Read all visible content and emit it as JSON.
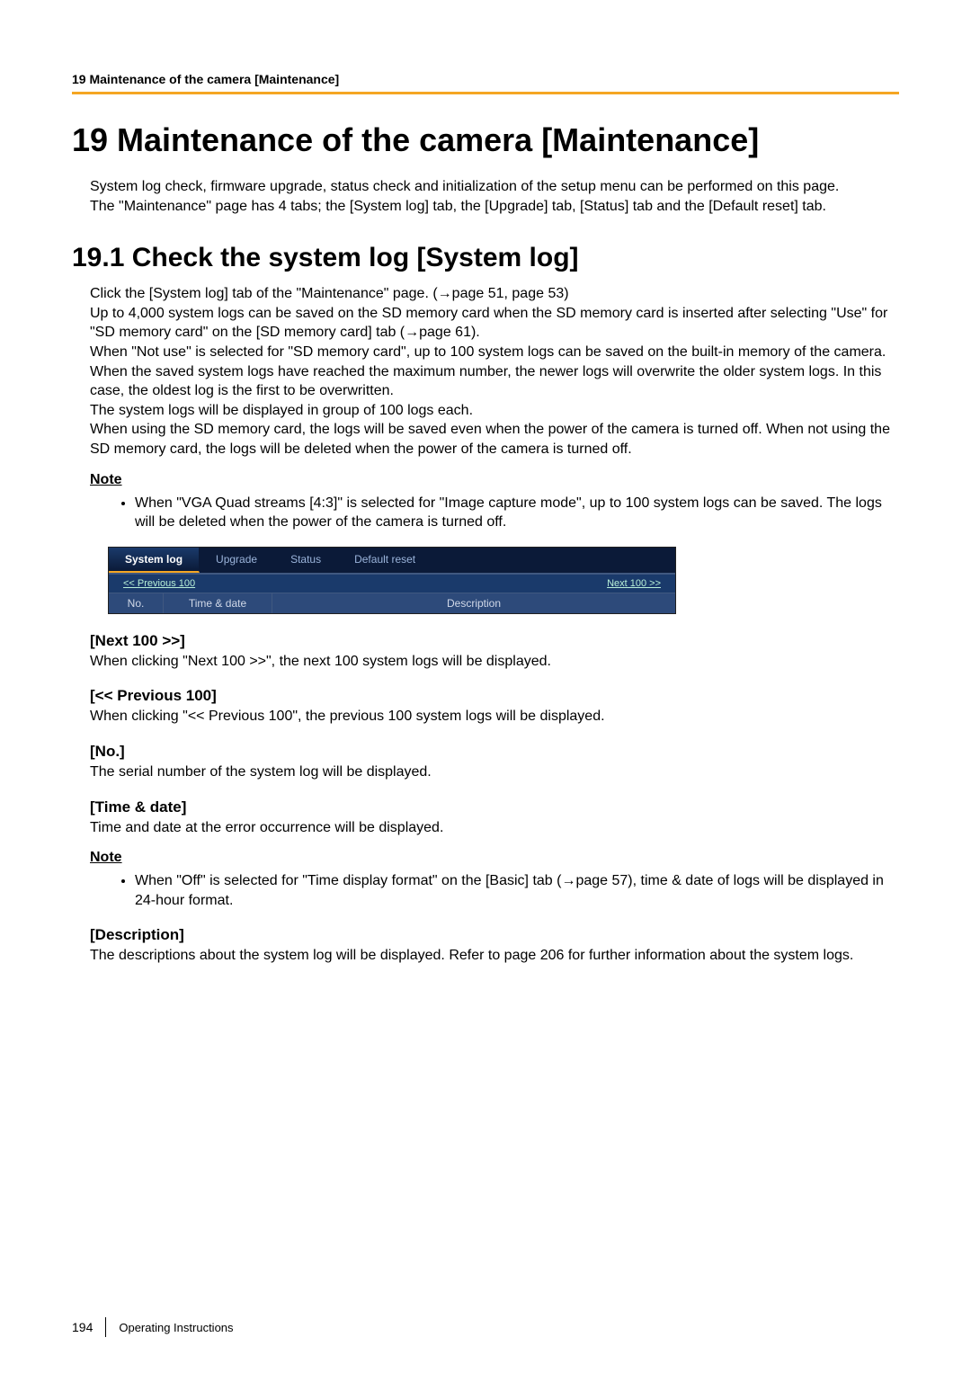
{
  "running_header": "19 Maintenance of the camera [Maintenance]",
  "chapter_title": "19   Maintenance of the camera [Maintenance]",
  "intro_p1": "System log check, firmware upgrade, status check and initialization of the setup menu can be performed on this page.",
  "intro_p2": "The \"Maintenance\" page has 4 tabs; the [System log] tab, the [Upgrade] tab, [Status] tab and the [Default reset] tab.",
  "section_title": "19.1  Check the system log [System log]",
  "body_lines": {
    "l1": "Click the [System log] tab of the \"Maintenance\" page. (→page 51, page 53)",
    "l2": "Up to 4,000 system logs can be saved on the SD memory card when the SD memory card is inserted after selecting \"Use\" for \"SD memory card\" on the [SD memory card] tab (→page 61).",
    "l3": "When \"Not use\" is selected for \"SD memory card\", up to 100 system logs can be saved on the built-in memory of the camera.",
    "l4": "When the saved system logs have reached the maximum number, the newer logs will overwrite the older system logs. In this case, the oldest log is the first to be overwritten.",
    "l5": "The system logs will be displayed in group of 100 logs each.",
    "l6": "When using the SD memory card, the logs will be saved even when the power of the camera is turned off. When not using the SD memory card, the logs will be deleted when the power of the camera is turned off."
  },
  "note1_heading": "Note",
  "note1_item": "When \"VGA Quad streams [4:3]\" is selected for \"Image capture mode\", up to 100 system logs can be saved. The logs will be deleted when the power of the camera is turned off.",
  "ui": {
    "tabs": {
      "system_log": "System log",
      "upgrade": "Upgrade",
      "status": "Status",
      "default_reset": "Default reset"
    },
    "prev_link": "<< Previous 100",
    "next_link": "Next 100  >>",
    "col_no": "No.",
    "col_time": "Time & date",
    "col_desc": "Description"
  },
  "sections": {
    "next100": {
      "title": "[Next 100 >>]",
      "desc": "When clicking \"Next 100 >>\", the next 100 system logs will be displayed."
    },
    "prev100": {
      "title": "[<< Previous 100]",
      "desc": "When clicking \"<< Previous 100\", the previous 100 system logs will be displayed."
    },
    "no": {
      "title": "[No.]",
      "desc": "The serial number of the system log will be displayed."
    },
    "timedate": {
      "title": "[Time & date]",
      "desc": "Time and date at the error occurrence will be displayed."
    },
    "timedate_note_heading": "Note",
    "timedate_note_item": "When \"Off\" is selected for \"Time display format\" on the [Basic] tab (→page 57), time & date of logs will be displayed in 24-hour format.",
    "description": {
      "title": "[Description]",
      "desc": "The descriptions about the system log will be displayed. Refer to page 206 for further information about the system logs."
    }
  },
  "footer": {
    "page_number": "194",
    "doc_title": "Operating Instructions"
  }
}
